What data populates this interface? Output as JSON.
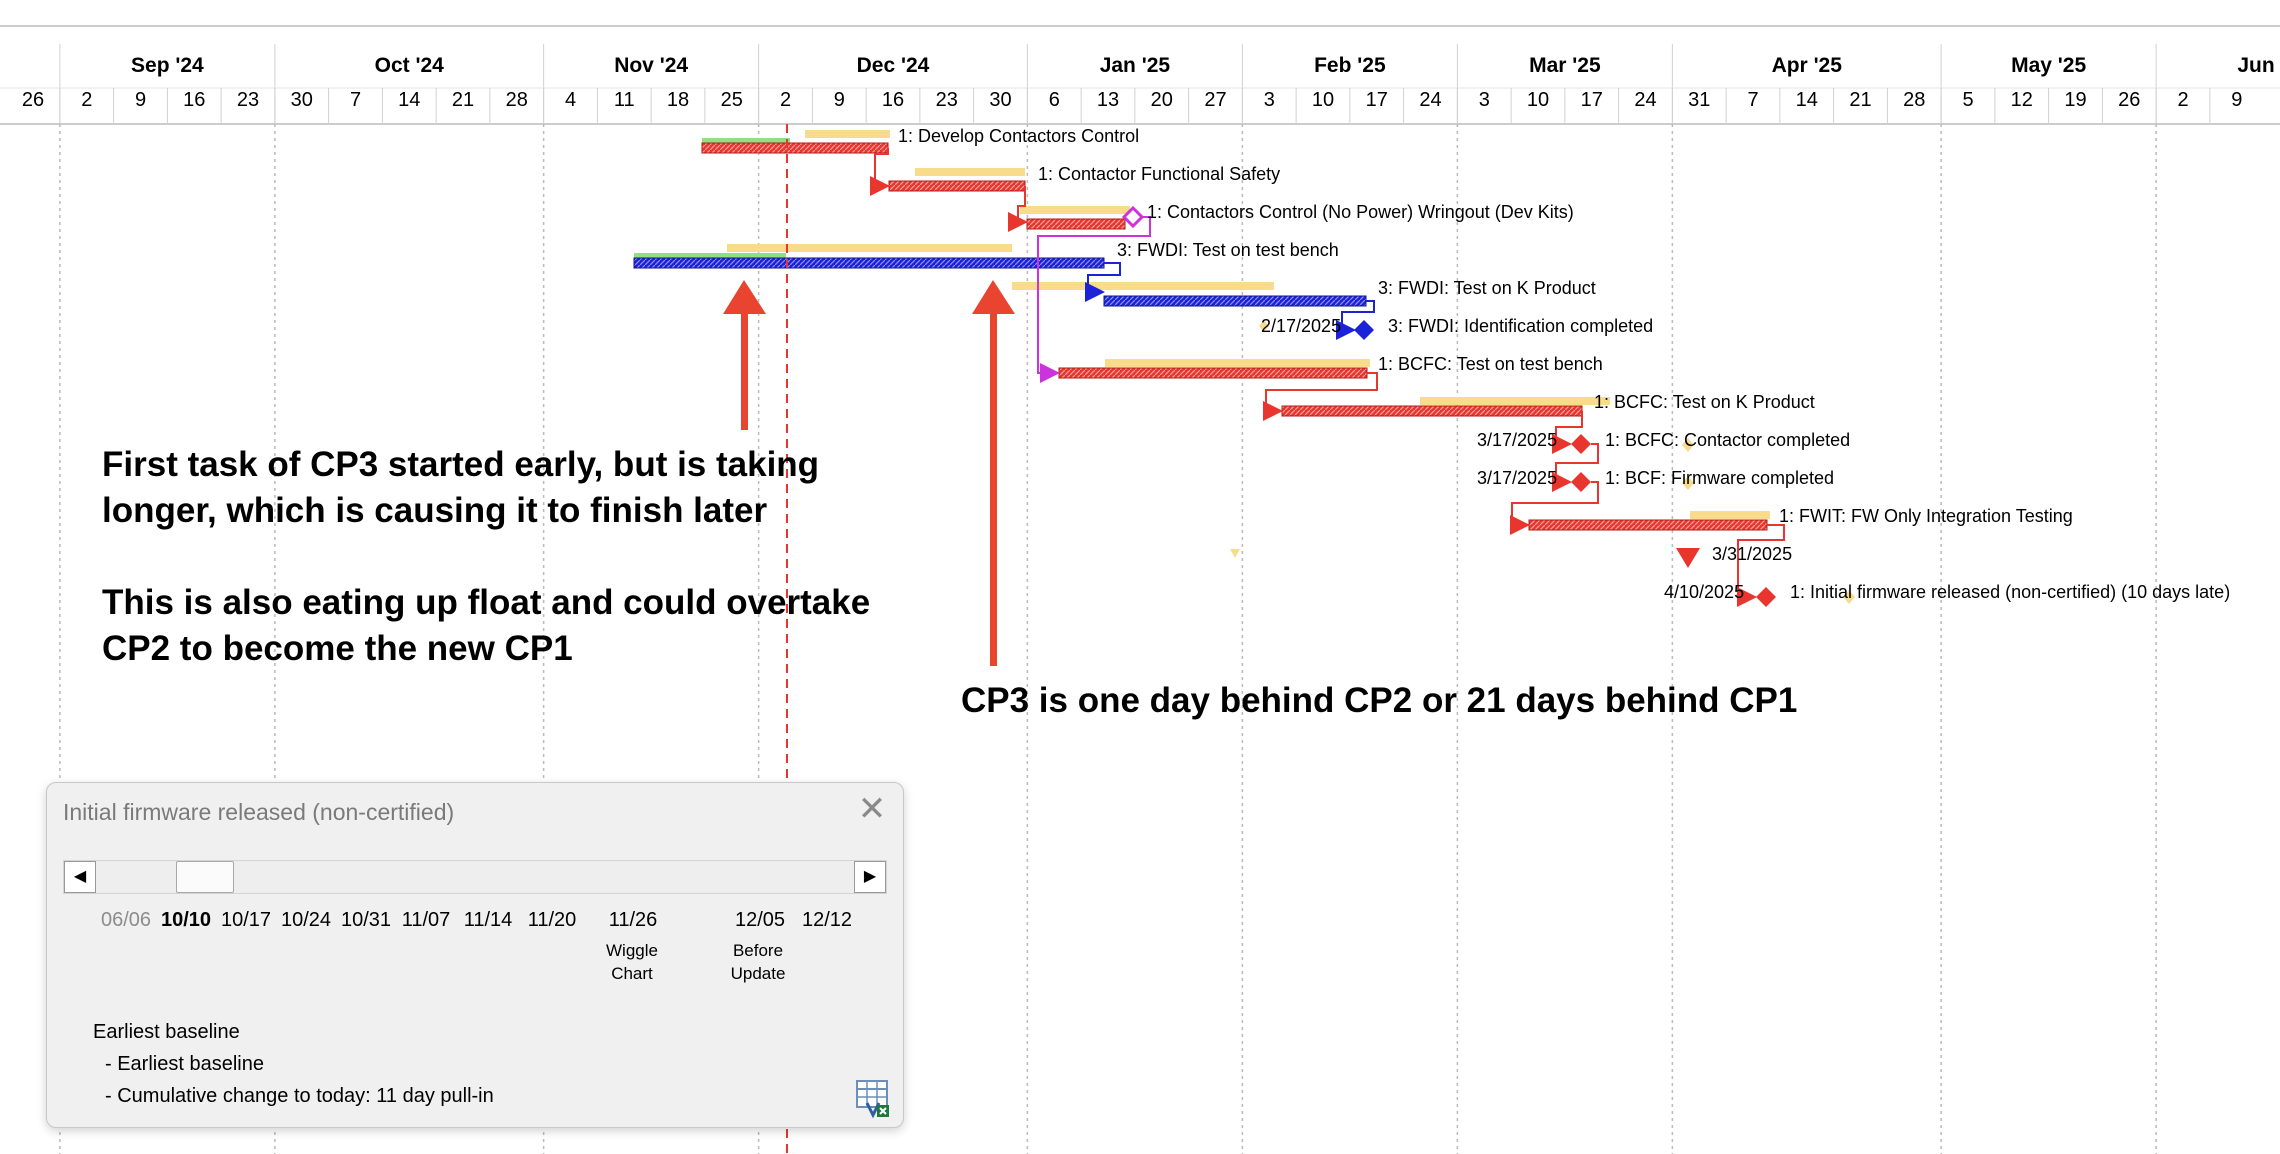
{
  "timescale": {
    "months": [
      "Sep '24",
      "Oct '24",
      "Nov '24",
      "Dec '24",
      "Jan '25",
      "Feb '25",
      "Mar '25",
      "Apr '25",
      "May '25",
      "Jun"
    ],
    "days": [
      "26",
      "2",
      "9",
      "16",
      "23",
      "30",
      "7",
      "14",
      "21",
      "28",
      "4",
      "11",
      "18",
      "25",
      "2",
      "9",
      "16",
      "23",
      "30",
      "6",
      "13",
      "20",
      "27",
      "3",
      "10",
      "17",
      "24",
      "3",
      "10",
      "17",
      "24",
      "31",
      "7",
      "14",
      "21",
      "28",
      "5",
      "12",
      "19",
      "26",
      "2",
      "9"
    ]
  },
  "tasks": [
    {
      "id": "t1",
      "label": "1: Develop Contactors Control"
    },
    {
      "id": "t2",
      "label": "1: Contactor Functional Safety"
    },
    {
      "id": "t3",
      "label": "1: Contactors Control (No Power) Wringout (Dev Kits)"
    },
    {
      "id": "t4",
      "label": "3: FWDI: Test on test bench"
    },
    {
      "id": "t5",
      "label": "3: FWDI: Test on K Product"
    },
    {
      "id": "t6",
      "label": "3: FWDI: Identification completed",
      "date_label": "2/17/2025"
    },
    {
      "id": "t7",
      "label": "1: BCFC: Test on test bench"
    },
    {
      "id": "t8",
      "label": "1: BCFC: Test on K Product"
    },
    {
      "id": "t9",
      "label": "1: BCFC: Contactor completed",
      "date_label": "3/17/2025"
    },
    {
      "id": "t10",
      "label": "1: BCF: Firmware completed",
      "date_label": "3/17/2025"
    },
    {
      "id": "t11",
      "label": "1: FWIT: FW Only Integration Testing"
    },
    {
      "id": "t12",
      "label": "",
      "date_label": "3/31/2025"
    },
    {
      "id": "t13",
      "label": "1: Initial firmware released (non-certified)  (10 days late)",
      "date_label": "4/10/2025"
    }
  ],
  "annotations": {
    "left_line1": "First task of CP3 started early, but is taking",
    "left_line2": "longer, which is causing it to finish later",
    "left_line3": "This is also eating up float and could overtake",
    "left_line4": "CP2 to become the new CP1",
    "right": "CP3 is one day behind CP2 or 21 days behind CP1"
  },
  "dialog": {
    "title": "Initial firmware released (non-certified)",
    "dates": [
      "06/06",
      "10/10",
      "10/17",
      "10/24",
      "10/31",
      "11/07",
      "11/14",
      "11/20",
      "11/26",
      "12/05",
      "12/12"
    ],
    "sublabel_1": "Wiggle\nChart",
    "sublabel_2": "Before\nUpdate",
    "info1": "Earliest baseline",
    "info2": "- Earliest baseline",
    "info3": "- Cumulative change to today: 11 day pull-in"
  },
  "colors": {
    "baseline": "#f8dc8c",
    "cp1_bar": "#e8352e",
    "cp3_bar": "#1c22d8",
    "progress": "#8fe07e",
    "status_line": "#e8352e",
    "link_magenta": "#cc33dd",
    "arrow": "#e8442f"
  }
}
